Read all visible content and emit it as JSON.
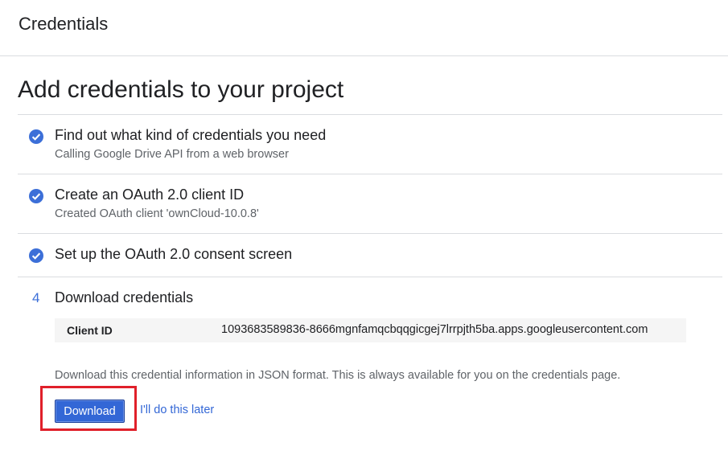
{
  "header": {
    "title": "Credentials"
  },
  "page_title": "Add credentials to your project",
  "steps": [
    {
      "status": "complete",
      "title": "Find out what kind of credentials you need",
      "subtitle": "Calling Google Drive API from a web browser"
    },
    {
      "status": "complete",
      "title": "Create an OAuth 2.0 client ID",
      "subtitle": "Created OAuth client 'ownCloud-10.0.8'"
    },
    {
      "status": "complete",
      "title": "Set up the OAuth 2.0 consent screen"
    },
    {
      "status": "current",
      "number": "4",
      "title": "Download credentials"
    }
  ],
  "client_id": {
    "label": "Client ID",
    "value": "1093683589836-8666mgnfamqcbqqgicgej7lrrpjth5ba.apps.googleusercontent.com"
  },
  "download": {
    "note": "Download this credential information in JSON format. This is always available for you on the credentials page.",
    "button_label": "Download",
    "later_label": "I'll do this later"
  },
  "colors": {
    "accent": "#3367d6",
    "check": "#3c6fd8",
    "highlight": "#e0202a",
    "divider": "#dadce0"
  },
  "icons": {
    "complete_step": "check-circle-icon"
  }
}
